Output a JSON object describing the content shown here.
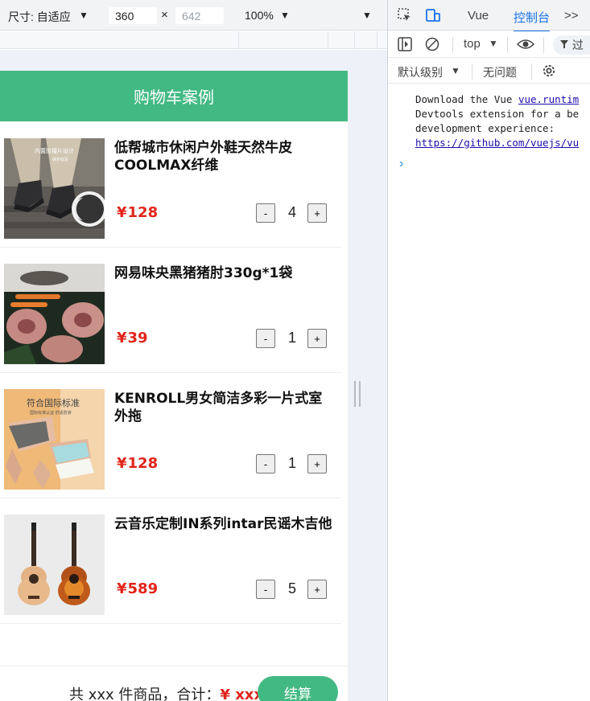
{
  "device_toolbar": {
    "dimensions_label": "尺寸: 自适应",
    "width_value": "360",
    "height_value": "642",
    "times_symbol": "×",
    "zoom_value": "100%",
    "caret": "▼"
  },
  "app": {
    "title": "购物车案例",
    "currency_symbol": "¥",
    "goods": [
      {
        "title": "低帮城市休闲户外鞋天然牛皮COOLMAX纤维",
        "price": "128",
        "count": "4",
        "image_caption_1": "内置防撞片设计",
        "image_caption_2": "保护双足",
        "minus_label": "-",
        "plus_label": "+"
      },
      {
        "title": "网易味央黑猪猪肘330g*1袋",
        "price": "39",
        "count": "1",
        "minus_label": "-",
        "plus_label": "+"
      },
      {
        "title": "KENROLL男女简洁多彩一片式室外拖",
        "price": "128",
        "count": "1",
        "image_caption_1": "符合国际标准",
        "image_caption_2": "国际标准认证·舒适防滑",
        "minus_label": "-",
        "plus_label": "+"
      },
      {
        "title": "云音乐定制IN系列intar民谣木吉他",
        "price": "589",
        "count": "5",
        "minus_label": "-",
        "plus_label": "+"
      }
    ],
    "footer": {
      "summary_prefix": "共 xxx 件商品，合计：",
      "total": "¥ xxx",
      "checkout_label": "结算"
    }
  },
  "devtools": {
    "tabs": [
      "Vue",
      "控制台"
    ],
    "more_tabs": ">>",
    "context_select": "top",
    "filter_placeholder": "过",
    "level_select": "默认级别",
    "issues_label": "无问题",
    "console_message": {
      "line1_text": "Download the Vue ",
      "line1_link": "vue.runtim",
      "line2": "Devtools extension for a be",
      "line3": "development experience:",
      "line4_link": "https://github.com/vuejs/vu"
    },
    "prompt_symbol": "›"
  },
  "colors": {
    "brand_green": "#42b983",
    "price_red": "#e1251b",
    "devtools_blue": "#1a73e8"
  }
}
